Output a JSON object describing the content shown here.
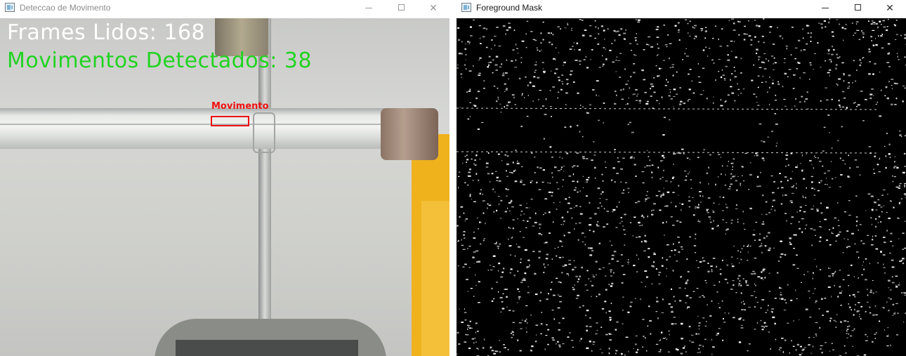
{
  "windows": [
    {
      "title": "Deteccao de Movimento",
      "controls": {
        "minimize": "minimize-icon",
        "maximize": "maximize-icon",
        "close": "close-icon"
      }
    },
    {
      "title": "Foreground Mask",
      "controls": {
        "minimize": "minimize-icon",
        "maximize": "maximize-icon",
        "close": "close-icon"
      }
    }
  ],
  "overlay": {
    "frames_text": "Frames Lidos: 168",
    "movements_text": "Movimentos Detectados: 38",
    "detection_label": "Movimento"
  },
  "colors": {
    "frames_text": "#ffffff",
    "movements_text": "#21d321",
    "detection_box": "#ee1111",
    "mask_background": "#000000",
    "mask_foreground": "#ffffff"
  }
}
